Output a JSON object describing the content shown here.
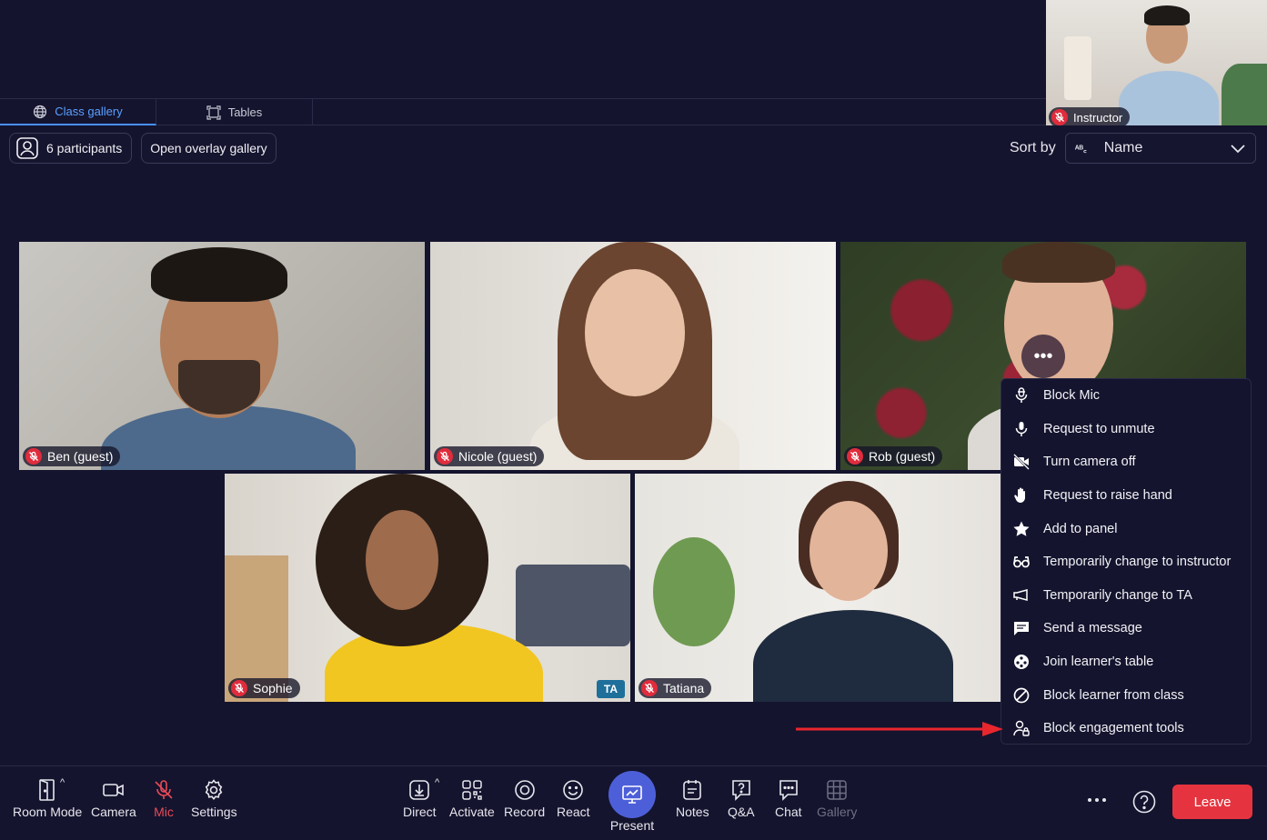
{
  "tabs": [
    {
      "label": "Class gallery",
      "icon": "globe-icon",
      "active": true
    },
    {
      "label": "Tables",
      "icon": "tables-icon",
      "active": false
    }
  ],
  "instructor_tile": {
    "name": "Instructor"
  },
  "gallery_toolbar": {
    "participants_label": "6 participants",
    "overlay_label": "Open overlay gallery"
  },
  "sort": {
    "label": "Sort by",
    "selected": "Name"
  },
  "tiles": [
    {
      "name": "Ben (guest)"
    },
    {
      "name": "Nicole (guest)"
    },
    {
      "name": "Rob (guest)"
    },
    {
      "name": "Sophie",
      "badge": "TA"
    },
    {
      "name": "Tatiana"
    }
  ],
  "context_menu": {
    "items": [
      {
        "label": "Block Mic",
        "icon": "block-mic-icon"
      },
      {
        "label": "Request to unmute",
        "icon": "microphone-icon"
      },
      {
        "label": "Turn camera off",
        "icon": "camera-off-icon"
      },
      {
        "label": "Request to raise hand",
        "icon": "hand-icon"
      },
      {
        "label": "Add to panel",
        "icon": "star-icon"
      },
      {
        "label": "Temporarily change to instructor",
        "icon": "glasses-icon"
      },
      {
        "label": "Temporarily change to TA",
        "icon": "megaphone-icon"
      },
      {
        "label": "Send a message",
        "icon": "message-icon"
      },
      {
        "label": "Join learner's table",
        "icon": "table-icon"
      },
      {
        "label": "Block learner from class",
        "icon": "block-icon"
      },
      {
        "label": "Block engagement tools",
        "icon": "user-lock-icon"
      }
    ]
  },
  "bottom_bar": {
    "room_mode": "Room Mode",
    "camera": "Camera",
    "mic": "Mic",
    "settings": "Settings",
    "direct": "Direct",
    "activate": "Activate",
    "record": "Record",
    "react": "React",
    "present": "Present",
    "notes": "Notes",
    "qa": "Q&A",
    "chat": "Chat",
    "gallery": "Gallery",
    "leave": "Leave"
  },
  "colors": {
    "background": "#14142e",
    "accent": "#4a8fff",
    "present": "#4d5fd8",
    "leave": "#e5343f",
    "mic_off": "#e02c3c",
    "arrow": "#e8262e"
  }
}
